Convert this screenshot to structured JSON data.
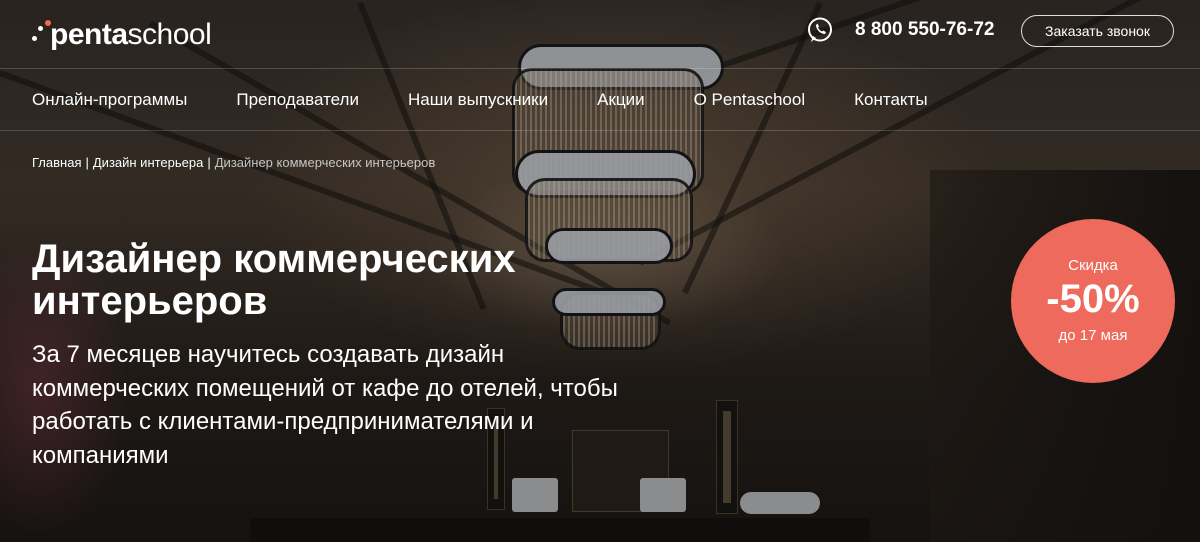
{
  "brand": {
    "logo_bold": "penta",
    "logo_light": "school",
    "accent": "#f26b4f"
  },
  "header": {
    "phone_icon": "whatsapp-icon",
    "phone": "8 800 550-76-72",
    "callback_label": "Заказать звонок"
  },
  "nav": {
    "items": [
      {
        "label": "Онлайн-программы"
      },
      {
        "label": "Преподаватели"
      },
      {
        "label": "Наши выпускники"
      },
      {
        "label": "Акции"
      },
      {
        "label": "О Pentaschool"
      },
      {
        "label": "Контакты"
      }
    ]
  },
  "breadcrumb": {
    "home": "Главная",
    "section": "Дизайн интерьера",
    "current": "Дизайнер коммерческих интерьеров",
    "separator": "|"
  },
  "hero": {
    "title": "Дизайнер коммерческих интерьеров",
    "subtitle": "За 7 месяцев научитесь создавать дизайн коммерческих помещений от кафе до отелей, чтобы работать с клиентами-предпринимателями и компаниями"
  },
  "discount": {
    "label": "Скидка",
    "value": "-50%",
    "until": "до 17 мая",
    "color": "#ee6a5c"
  }
}
